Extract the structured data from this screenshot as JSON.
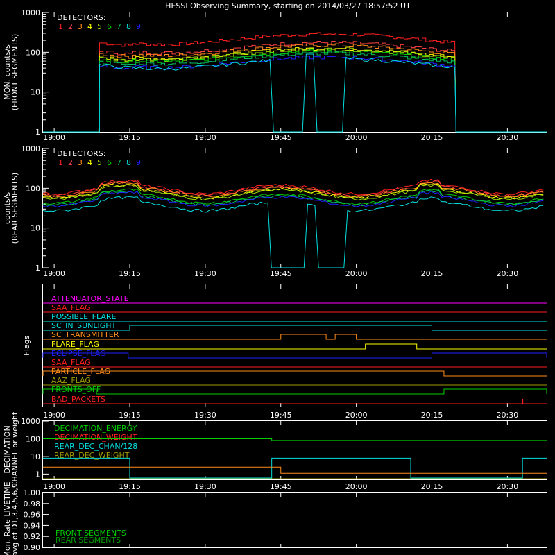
{
  "title": "HESSI Observing Summary, starting on 2014/03/27 18:57:52 UT",
  "x_tick_labels": [
    "19:00",
    "19:15",
    "19:30",
    "19:45",
    "20:00",
    "20:15",
    "20:30"
  ],
  "detectors_label": "DETECTORS:",
  "detector_numbers": [
    "1",
    "2",
    "3",
    "4",
    "5",
    "6",
    "7",
    "8",
    "9"
  ],
  "colors": {
    "background": "#000000",
    "axes": "#ffffff",
    "det": [
      "#ff2020",
      "#ff4040",
      "#ff8c1a",
      "#ffff00",
      "#a0e000",
      "#00d000",
      "#00c060",
      "#00e0e0",
      "#2020ff"
    ],
    "magenta": "#ff00ff",
    "red": "#ff2020",
    "cyan": "#00e0e0",
    "orange": "#ff8c1a",
    "yellow": "#ffff00",
    "blue": "#2020ff",
    "olive": "#a09a00",
    "green": "#00d000"
  },
  "chart_data": [
    {
      "type": "line",
      "ylabel": "MON. counts/s\n(FRONT SEGMENTS)",
      "yscale": "log",
      "ylim": [
        1,
        1000
      ],
      "ytick_labels": [
        "1",
        "10",
        "100",
        "1000"
      ],
      "xlim": [
        18.963,
        20.63
      ],
      "x_unit": "hours UT",
      "legend": "DETECTORS: 1 2 3 4 5 6 7 8 9",
      "series_note": "rates ~50-250 counts/s from 19:10 to 20:20, zero outside; det 8 drops out 19:43-20:00",
      "t_start": 19.15,
      "t_end": 20.33,
      "levels_mid": [
        230,
        140,
        120,
        100,
        95,
        85,
        75,
        70,
        60
      ]
    },
    {
      "type": "line",
      "ylabel": "counts/s\n(REAR SEGMENTS)",
      "yscale": "log",
      "ylim": [
        1,
        1000
      ],
      "ytick_labels": [
        "1",
        "10",
        "100",
        "1000"
      ],
      "xlim": [
        18.963,
        20.63
      ],
      "legend": "DETECTORS: 1 2 3 4 5 6 7 8 9",
      "series_note": "rates ~40-130 counts/s all interval; det 8 drops out 19:43-20:00"
    },
    {
      "type": "table",
      "ylabel": "Flags",
      "flags": [
        "ATTENUATOR_STATE",
        "SAA_FLAG",
        "POSSIBLE_FLARE",
        "SC_IN_SUNLIGHT",
        "SC_TRANSMITTER",
        "FLARE_FLAG",
        "ECLIPSE_FLAG",
        "SAA_FLAG",
        "PARTICLE_FLAG",
        "AAZ_FLAG",
        "FRONTS_OFF",
        "BAD_PACKETS"
      ]
    },
    {
      "type": "line",
      "ylabel": "DECIMATION\nCHANNEL or weight",
      "yscale": "log",
      "ylim": [
        0.5,
        1000
      ],
      "ytick_labels": [
        "1",
        "10",
        "100",
        "1000"
      ],
      "legend": [
        "DECIMATION_ENERGY",
        "DECIMATION_WEIGHT",
        "REAR_DEC_CHAN/128",
        "REAR_DEC_WEIGHT"
      ]
    },
    {
      "type": "line",
      "ylabel": "Mon. Rate LIVETIME\navg of D1,3,4,5,6,9",
      "ylim": [
        0.9,
        1.0
      ],
      "ytick_labels": [
        "0.90",
        "0.92",
        "0.94",
        "0.96",
        "0.98",
        "1.00"
      ],
      "legend": [
        "FRONT SEGMENTS",
        "REAR SEGMENTS"
      ]
    }
  ]
}
